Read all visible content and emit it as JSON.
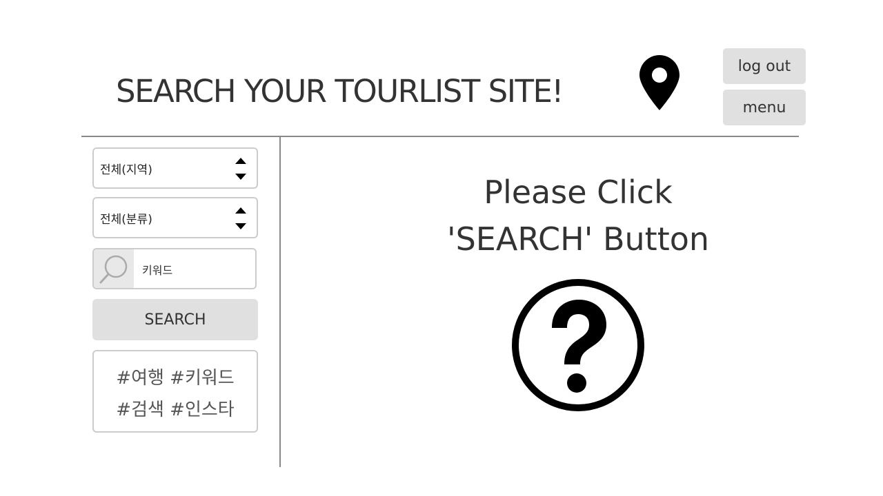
{
  "header": {
    "title": "SEARCH YOUR TOURLIST SITE!",
    "location_icon": "map-pin-icon",
    "logout_label": "log out",
    "menu_label": "menu"
  },
  "sidebar": {
    "region_select": {
      "selected": "전체(지역)",
      "icon": "up-down-stepper-icon"
    },
    "category_select": {
      "selected": "전체(분류)",
      "icon": "up-down-stepper-icon"
    },
    "keyword_input": {
      "placeholder": "키워드",
      "value": "",
      "icon": "search-icon"
    },
    "search_button_label": "SEARCH",
    "hashtags": {
      "line1": "#여행 #키워드",
      "line2": "#검색 #인스타"
    }
  },
  "main": {
    "prompt_line1": "Please Click",
    "prompt_line2": "'SEARCH' Button",
    "prompt_icon": "question-mark-circle-icon"
  },
  "colors": {
    "button_bg": "#e0e0e0",
    "border": "#cccccc",
    "divider": "#888888",
    "text": "#333333"
  }
}
